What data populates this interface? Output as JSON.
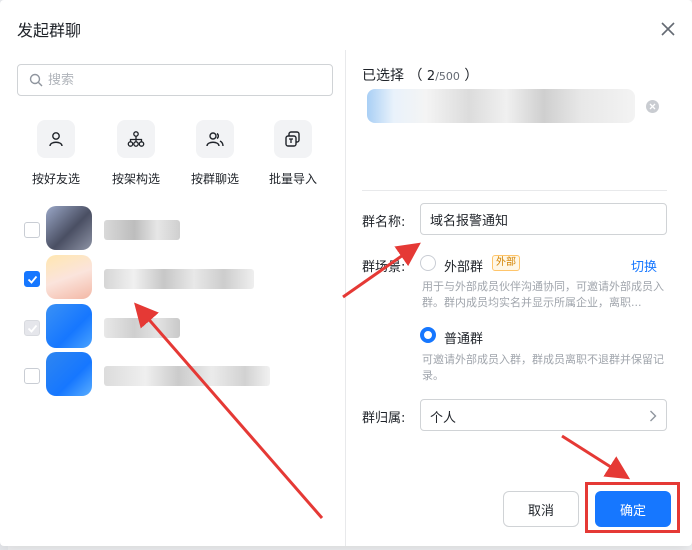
{
  "dialog": {
    "title": "发起群聊"
  },
  "search": {
    "placeholder": "搜索"
  },
  "quick_actions": [
    {
      "label": "按好友选",
      "icon": "person-icon"
    },
    {
      "label": "按架构选",
      "icon": "org-structure-icon"
    },
    {
      "label": "按群聊选",
      "icon": "group-icon"
    },
    {
      "label": "批量导入",
      "icon": "import-icon"
    }
  ],
  "selected": {
    "label": "已选择",
    "count": "2",
    "max": "/500"
  },
  "group_name": {
    "label": "群名称:",
    "value": "域名报警通知"
  },
  "scene": {
    "label": "群场景:",
    "external": {
      "label": "外部群",
      "tag": "外部",
      "switch": "切换",
      "desc": "用于与外部成员伙伴沟通协同，可邀请外部成员入群。群内成员均实名并显示所属企业，离职..."
    },
    "normal": {
      "label": "普通群",
      "desc": "可邀请外部成员入群，群成员离职不退群并保留记录。"
    }
  },
  "owner": {
    "label": "群归属:",
    "value": "个人"
  },
  "buttons": {
    "cancel": "取消",
    "ok": "确定"
  },
  "colors": {
    "primary": "#1677ff",
    "annotation": "#e53935",
    "external_tag": "#d38200"
  }
}
